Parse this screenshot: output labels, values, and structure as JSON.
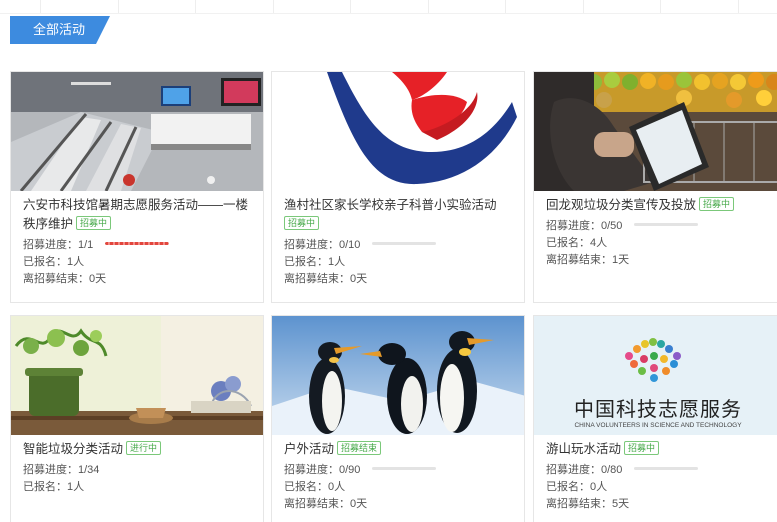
{
  "section": {
    "tab_label": "全部活动"
  },
  "labels": {
    "progress_prefix": "招募进度：",
    "signed_prefix": "已报名：",
    "deadline_prefix": "离招募结束："
  },
  "colors": {
    "accent": "#3d8bdf",
    "badge": "#47a94a",
    "progress_fill": "#e2463d",
    "progress_track": "#e3e3e3"
  },
  "cards": [
    {
      "title": "六安市科技馆暑期志愿服务活动——一楼秩序维护",
      "badge": "招募中",
      "progress": "1/1",
      "progress_fraction": 1,
      "signed": "1人",
      "deadline": "0天",
      "image": "science-museum-photo"
    },
    {
      "title": "渔村社区家长学校亲子科普小实验活动",
      "badge": "招募中",
      "progress": "0/10",
      "progress_fraction": 0,
      "signed": "1人",
      "deadline": "0天",
      "image": "volunteer-logo"
    },
    {
      "title": "回龙观垃圾分类宣传及投放",
      "badge": "招募中",
      "progress": "0/50",
      "progress_fraction": 0,
      "signed": "4人",
      "deadline": "1天",
      "image": "tablet-shopping-photo"
    },
    {
      "title": "智能垃圾分类活动",
      "badge": "进行中",
      "progress": "1/34",
      "progress_fraction": 0.03,
      "signed": "1人",
      "image": "tea-still-life-photo"
    },
    {
      "title": "户外活动",
      "badge": "招募结束",
      "progress": "0/90",
      "progress_fraction": 0,
      "signed": "0人",
      "deadline": "0天",
      "image": "penguins-photo"
    },
    {
      "title": "游山玩水活动",
      "badge": "招募中",
      "progress": "0/80",
      "progress_fraction": 0,
      "signed": "0人",
      "deadline": "5天",
      "image": "china-volunteers-logo",
      "logo_text": "中国科技志愿服务",
      "logo_subtext": "CHINA VOLUNTEERS IN SCIENCE AND TECHNOLOGY"
    }
  ]
}
